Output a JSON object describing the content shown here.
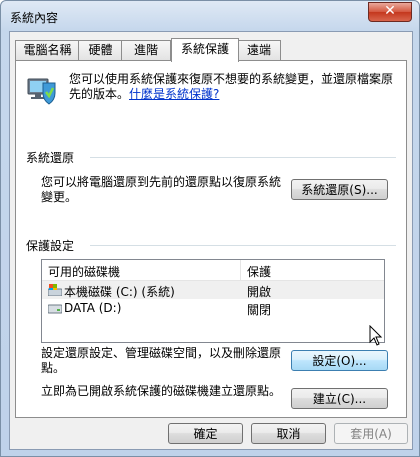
{
  "window": {
    "title": "系統內容",
    "close_symbol": "✕"
  },
  "tabs": [
    {
      "label": "電腦名稱"
    },
    {
      "label": "硬體"
    },
    {
      "label": "進階"
    },
    {
      "label": "系統保護",
      "active": true
    },
    {
      "label": "遠端"
    }
  ],
  "intro": {
    "text": "您可以使用系統保護來復原不想要的系統變更，並還原檔案原先的版本。",
    "link": "什麼是系統保護?"
  },
  "system_restore": {
    "group_label": "系統還原",
    "description": "您可以將電腦還原到先前的還原點以復原系統變更。",
    "button": "系統還原(S)..."
  },
  "protection": {
    "group_label": "保護設定",
    "columns": [
      "可用的磁碟機",
      "保護"
    ],
    "rows": [
      {
        "drive": "本機磁碟 (C:) (系統)",
        "protection": "開啟",
        "icon": "system-drive-icon"
      },
      {
        "drive": "DATA (D:)",
        "protection": "關閉",
        "icon": "drive-icon"
      }
    ],
    "configure_text": "設定還原設定、管理磁碟空間，以及刪除還原點。",
    "configure_button": "設定(O)...",
    "create_text": "立即為已開啟系統保護的磁碟機建立還原點。",
    "create_button": "建立(C)..."
  },
  "footer": {
    "ok": "確定",
    "cancel": "取消",
    "apply": "套用(A)"
  },
  "colors": {
    "link": "#0033cc",
    "close_button": "#c4371d",
    "hot_button_border": "#3c7fb1"
  }
}
